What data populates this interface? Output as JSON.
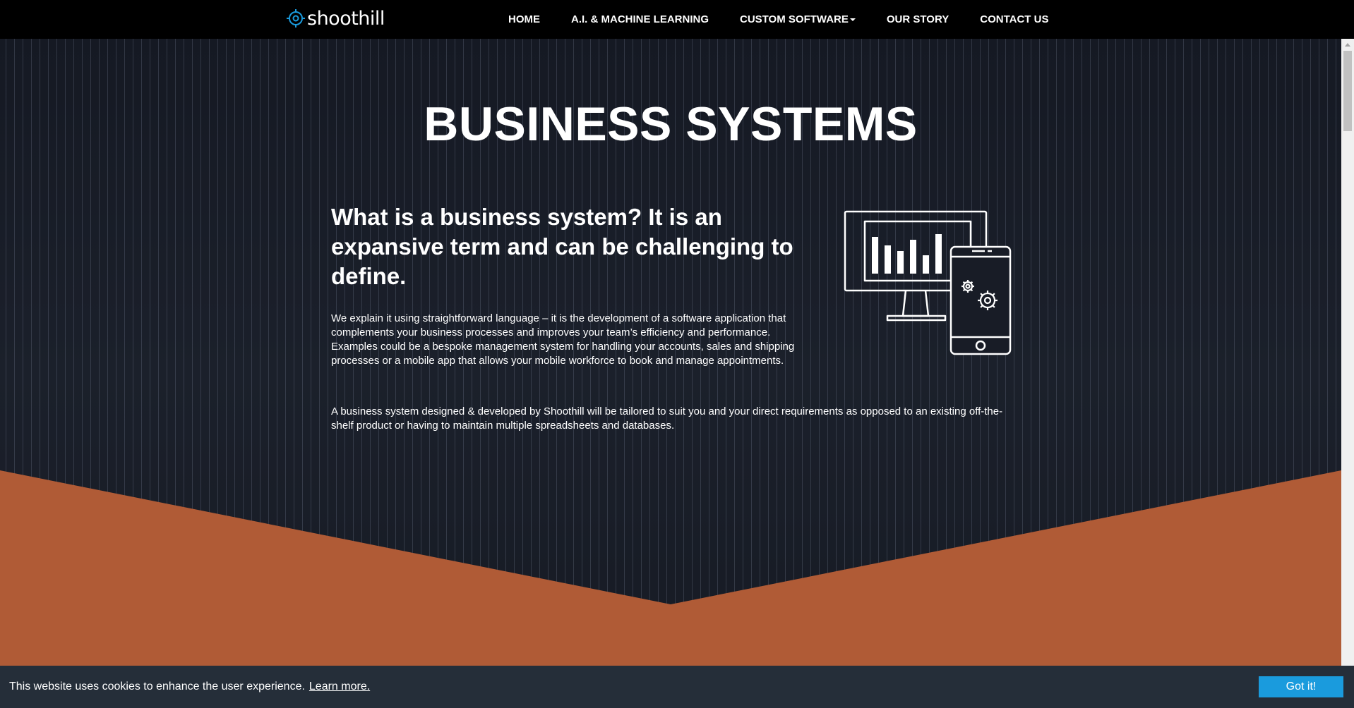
{
  "brand": {
    "name": "shoothill",
    "accent": "#1a9bdd"
  },
  "nav": {
    "items": [
      {
        "label": "HOME"
      },
      {
        "label": "A.I. & MACHINE LEARNING"
      },
      {
        "label": "CUSTOM SOFTWARE",
        "has_dropdown": true
      },
      {
        "label": "OUR STORY"
      },
      {
        "label": "CONTACT US"
      }
    ]
  },
  "hero": {
    "title": "BUSINESS SYSTEMS",
    "heading": "What is a business system? It is an expansive term and can be challenging to define.",
    "paragraph1": "We explain it using straightforward language – it is the development of a software application that complements your business processes and improves your team’s efficiency and performance. Examples could be a bespoke management system for handling your accounts, sales and shipping processes or a mobile app that allows your mobile workforce to book and manage appointments.",
    "paragraph2": "A business system designed & developed by Shoothill will be tailored to suit you and your direct requirements as opposed to an existing off-the-shelf product or having to maintain multiple spreadsheets and databases.",
    "illustration_icon": "monitor-and-phone-icon",
    "wedge_color": "#b05b36"
  },
  "cookie": {
    "text": "This website uses cookies to enhance the user experience.",
    "link": "Learn more.",
    "button": "Got it!"
  }
}
